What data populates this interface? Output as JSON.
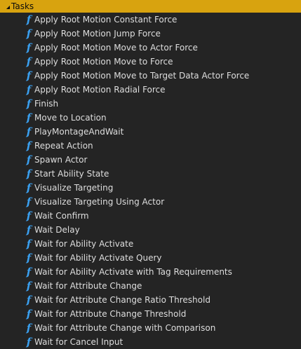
{
  "category": {
    "title": "Tasks"
  },
  "colors": {
    "header_bg": "#d8a30f",
    "background": "#242424",
    "function_icon": "#3aa0f0",
    "text": "#dedede"
  },
  "items": [
    {
      "label": "Apply Root Motion Constant Force",
      "icon": "function-icon"
    },
    {
      "label": "Apply Root Motion Jump Force",
      "icon": "function-icon"
    },
    {
      "label": "Apply Root Motion Move to Actor Force",
      "icon": "function-icon"
    },
    {
      "label": "Apply Root Motion Move to Force",
      "icon": "function-icon"
    },
    {
      "label": "Apply Root Motion Move to Target Data Actor Force",
      "icon": "function-icon"
    },
    {
      "label": "Apply Root Motion Radial Force",
      "icon": "function-icon"
    },
    {
      "label": "Finish",
      "icon": "function-icon"
    },
    {
      "label": "Move to Location",
      "icon": "function-icon"
    },
    {
      "label": "PlayMontageAndWait",
      "icon": "function-icon"
    },
    {
      "label": "Repeat Action",
      "icon": "function-icon"
    },
    {
      "label": "Spawn Actor",
      "icon": "function-icon"
    },
    {
      "label": "Start Ability State",
      "icon": "function-icon"
    },
    {
      "label": "Visualize Targeting",
      "icon": "function-icon"
    },
    {
      "label": "Visualize Targeting Using Actor",
      "icon": "function-icon"
    },
    {
      "label": "Wait Confirm",
      "icon": "function-icon"
    },
    {
      "label": "Wait Delay",
      "icon": "function-icon"
    },
    {
      "label": "Wait for Ability Activate",
      "icon": "function-icon"
    },
    {
      "label": "Wait for Ability Activate Query",
      "icon": "function-icon"
    },
    {
      "label": "Wait for Ability Activate with Tag Requirements",
      "icon": "function-icon"
    },
    {
      "label": "Wait for Attribute Change",
      "icon": "function-icon"
    },
    {
      "label": "Wait for Attribute Change Ratio Threshold",
      "icon": "function-icon"
    },
    {
      "label": "Wait for Attribute Change Threshold",
      "icon": "function-icon"
    },
    {
      "label": "Wait for Attribute Change with Comparison",
      "icon": "function-icon"
    },
    {
      "label": "Wait for Cancel Input",
      "icon": "function-icon"
    }
  ]
}
